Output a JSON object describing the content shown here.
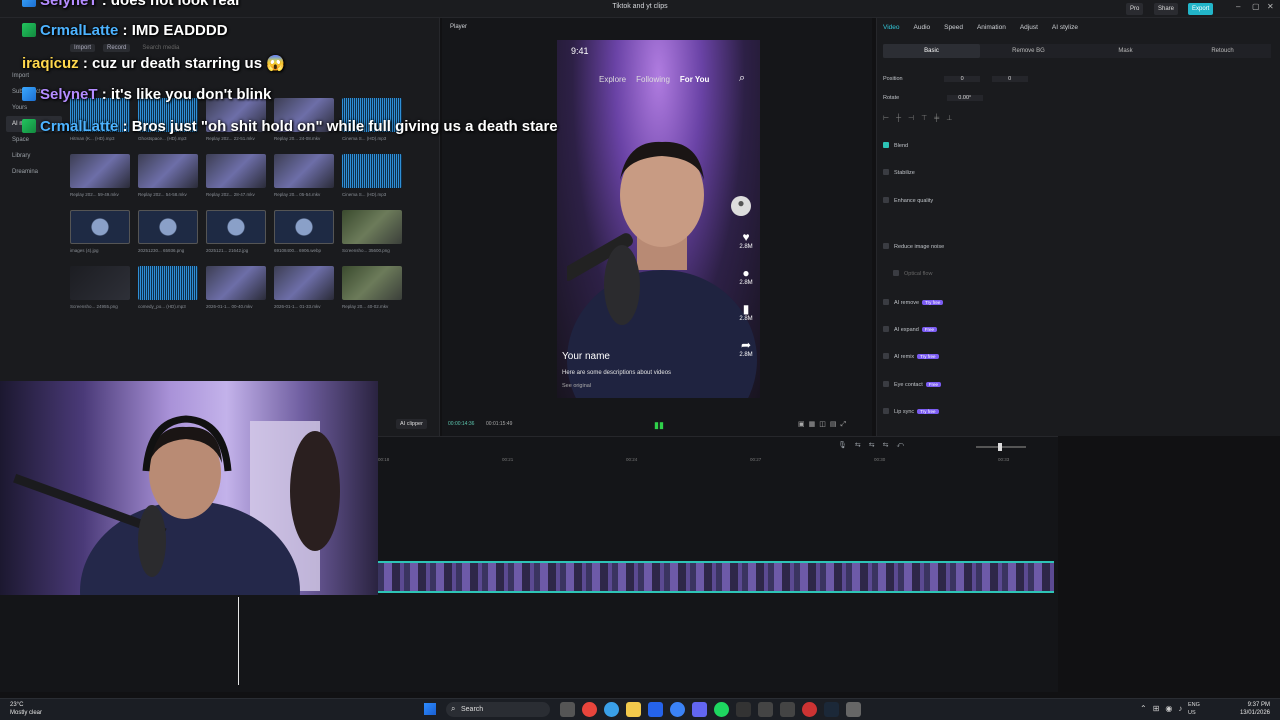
{
  "window": {
    "title": "Tiktok and yt clips",
    "pro_label": "Pro",
    "share_label": "Share",
    "export_label": "Export"
  },
  "media": {
    "tabs": [
      "Import",
      "Record"
    ],
    "search_placeholder": "Search media",
    "sidenav": [
      "Import",
      "Subprojects",
      "Yours",
      "AI media",
      "Space",
      "Library",
      "Dreamina"
    ],
    "tiles": [
      {
        "label": "Hitman (K... (HD).mp3",
        "kind": "audio"
      },
      {
        "label": "Ghostspace... (HD).mp3",
        "kind": "audio"
      },
      {
        "label": "Replay 202... 22-51.mkv",
        "kind": "video"
      },
      {
        "label": "Replay 20... 24-08.mkv",
        "kind": "video"
      },
      {
        "label": "Cinema S... (HD).mp3",
        "kind": "audio"
      },
      {
        "label": "Replay 202... 59-49.mkv",
        "kind": "video"
      },
      {
        "label": "Replay 202... 54-58.mkv",
        "kind": "video"
      },
      {
        "label": "Replay 202... 28-47.mkv",
        "kind": "video"
      },
      {
        "label": "Replay 20... 05-54.mkv",
        "kind": "video"
      },
      {
        "label": "Cinema S... (HD).mp3",
        "kind": "audio"
      },
      {
        "label": "images (4).jpg",
        "kind": "image"
      },
      {
        "label": "20251230... 65936.png",
        "kind": "image"
      },
      {
        "label": "2025121... 21642.jpg",
        "kind": "image"
      },
      {
        "label": "69108400... 6906.webp",
        "kind": "image"
      },
      {
        "label": "Screensho... 35600.png",
        "kind": "game"
      },
      {
        "label": "Screensho... 24955.png",
        "kind": "dark"
      },
      {
        "label": "comedy_po... (HD).mp3",
        "kind": "audio"
      },
      {
        "label": "2026-01-1... 00-40.mkv",
        "kind": "video"
      },
      {
        "label": "2026-01-1... 01-33.mkv",
        "kind": "video"
      },
      {
        "label": "Replay 20... 40-02.mkv",
        "kind": "game"
      }
    ]
  },
  "chat": [
    {
      "user": "SelyneT",
      "msg": "does not look real",
      "color": "#b48cff"
    },
    {
      "user": "CrmalLatte",
      "msg": "IMD EADDDD",
      "color": "#4db3ff"
    },
    {
      "user": "iraqicuz",
      "msg": "cuz ur death starring us 😱",
      "color": "#ffd84d"
    },
    {
      "user": "SelyneT",
      "msg": "it's like you don't blink",
      "color": "#b48cff"
    },
    {
      "user": "CrmalLatte",
      "msg": "Bros just \"oh shit hold on\" while full giving us a death stare",
      "color": "#4db3ff"
    }
  ],
  "player": {
    "header": "Player",
    "phone": {
      "time": "9:41",
      "tabs": [
        "Explore",
        "Following",
        "For You"
      ],
      "username": "Your name",
      "description": "Here are some descriptions about videos",
      "see_original": "See original",
      "counts": [
        "2.8M",
        "2.8M",
        "2.8M",
        "2.8M"
      ]
    },
    "timecode_current": "00:00:14:36",
    "timecode_total": "00:01:15:49",
    "ai_clipper": "AI clipper"
  },
  "props": {
    "tabs": [
      "Video",
      "Audio",
      "Speed",
      "Animation",
      "Adjust",
      "AI stylize"
    ],
    "subtabs": [
      "Basic",
      "Remove BG",
      "Mask",
      "Retouch"
    ],
    "position_label": "Position",
    "pos_x": "0",
    "pos_y": "0",
    "rotate_label": "Rotate",
    "rotate_value": "0.00°",
    "rows": [
      {
        "label": "Blend",
        "on": true,
        "tag": ""
      },
      {
        "label": "Stabilize",
        "on": false,
        "tag": ""
      },
      {
        "label": "Enhance quality",
        "on": false,
        "tag": ""
      },
      {
        "label": "Reduce image noise",
        "on": false,
        "tag": ""
      },
      {
        "label": "Optical flow",
        "on": false,
        "tag": ""
      },
      {
        "label": "AI remove",
        "on": false,
        "tag": "Try free"
      },
      {
        "label": "AI expand",
        "on": false,
        "tag": "Free"
      },
      {
        "label": "AI remix",
        "on": false,
        "tag": "Try free"
      },
      {
        "label": "Eye contact",
        "on": false,
        "tag": "Free"
      },
      {
        "label": "Lip sync",
        "on": false,
        "tag": "Try free"
      }
    ]
  },
  "timeline": {
    "ruler": [
      "00:18",
      "00:21",
      "00:24",
      "00:27",
      "00:30",
      "00:33"
    ]
  },
  "taskbar": {
    "temp": "23°C",
    "weather": "Mostly clear",
    "search": "Search",
    "lang": "ENG",
    "region": "US",
    "time": "9:37 PM",
    "date": "13/01/2026"
  }
}
